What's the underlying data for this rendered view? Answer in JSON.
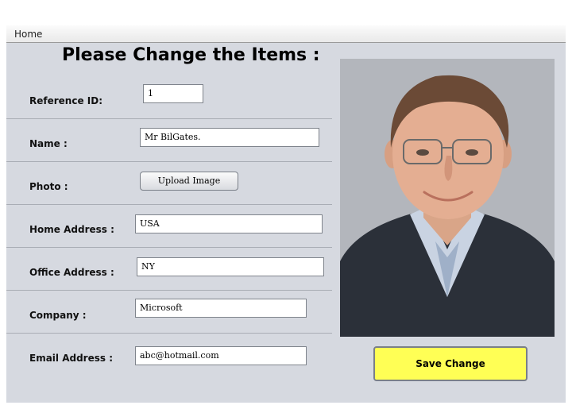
{
  "menu": {
    "home": "Home"
  },
  "form": {
    "title": "Please Change the Items :",
    "reference_id": {
      "label": "Reference ID:",
      "value": "1"
    },
    "name": {
      "label": "Name :",
      "value": "Mr BilGates."
    },
    "photo": {
      "label": "Photo :",
      "button": "Upload Image"
    },
    "home_address": {
      "label": "Home Address :",
      "value": "USA"
    },
    "office_address": {
      "label": "Office Address :",
      "value": "NY"
    },
    "company": {
      "label": "Company :",
      "value": "Microsoft"
    },
    "email": {
      "label": "Email Address :",
      "value": "abc@hotmail.com"
    }
  },
  "save_button": "Save Change",
  "colors": {
    "panel": "#d6d9e0",
    "save_button": "#ffff55"
  },
  "photo_icon": "profile-photo"
}
